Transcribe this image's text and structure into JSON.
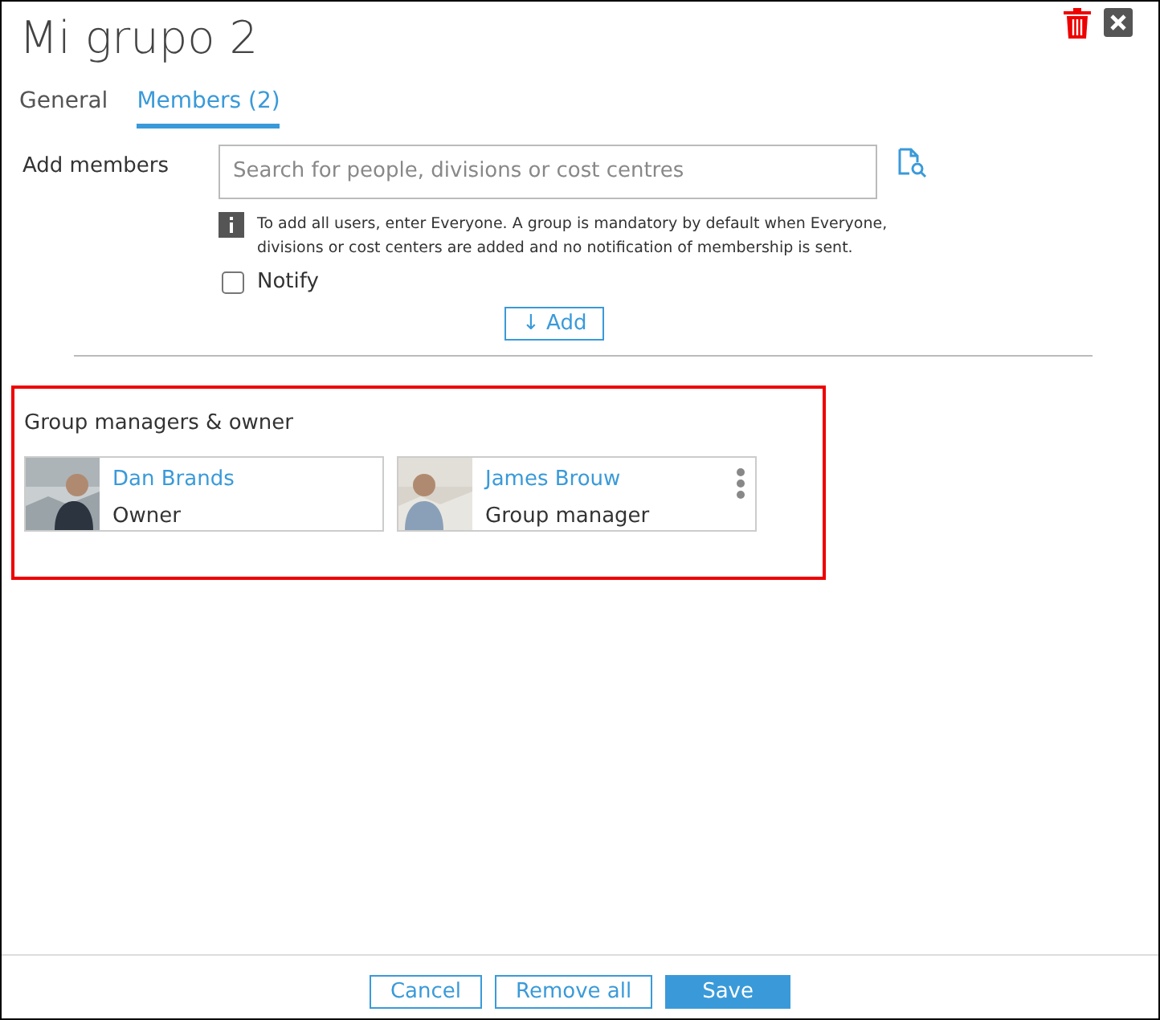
{
  "title": "Mi grupo 2",
  "tabs": [
    {
      "label": "General",
      "selected": false
    },
    {
      "label": "Members (2)",
      "selected": true
    }
  ],
  "add_members": {
    "label": "Add members",
    "placeholder": "Search for people, divisions or cost centres",
    "info": "To add all users, enter Everyone. A group is mandatory by default when Everyone, divisions or cost centers are added and no notification of membership is sent.",
    "notify": {
      "label": "Notify",
      "checked": false
    },
    "add_button": "↓ Add"
  },
  "managers": {
    "heading": "Group managers & owner",
    "highlighted": true,
    "people": [
      {
        "name": "Dan Brands",
        "role": "Owner",
        "menu": false
      },
      {
        "name": "James Brouw",
        "role": "Group manager",
        "menu": true
      }
    ]
  },
  "footer": [
    {
      "label": "Cancel",
      "kind": "outline"
    },
    {
      "label": "Remove all",
      "kind": "outline"
    },
    {
      "label": "Save",
      "kind": "primary"
    }
  ]
}
